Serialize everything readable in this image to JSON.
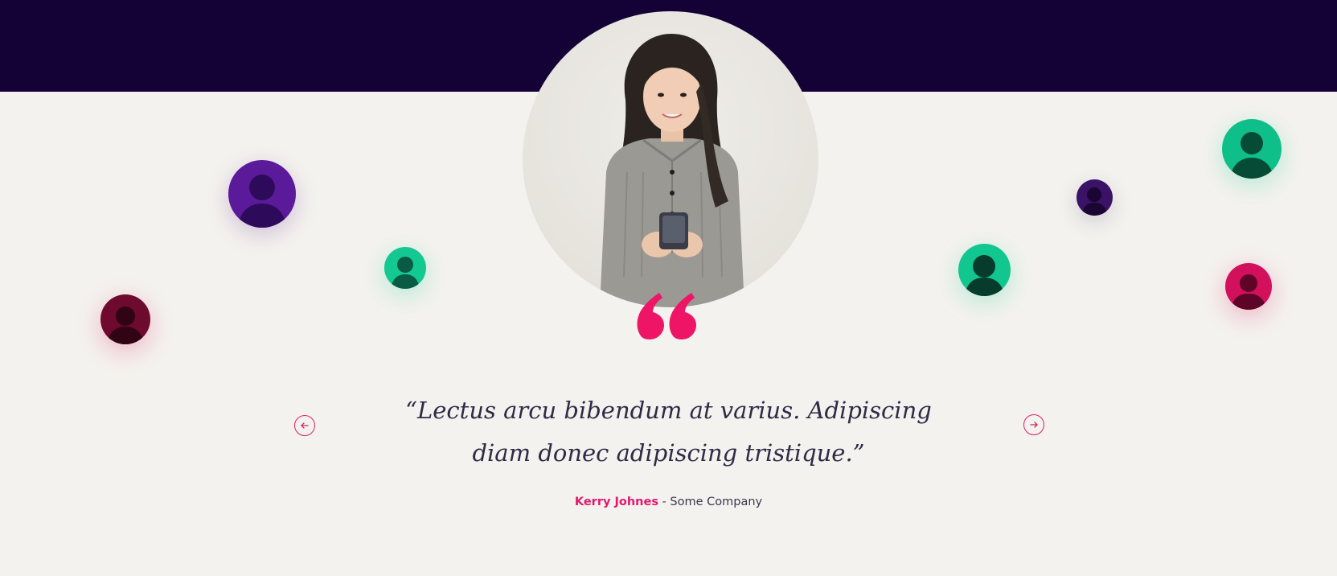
{
  "testimonial": {
    "quote_line_1": "“Lectus arcu bibendum at varius. Adipiscing",
    "quote_line_2": "diam donec adipiscing tristique.”",
    "author": "Kerry Johnes",
    "separator": " - ",
    "company": "Some Company"
  },
  "avatars": [
    {
      "tint": "purple",
      "color": "#5a1a9a"
    },
    {
      "tint": "green",
      "color": "#14c892"
    },
    {
      "tint": "crimson",
      "color": "#6e0a2e"
    },
    {
      "tint": "dark-purple",
      "color": "#3a1266"
    },
    {
      "tint": "green",
      "color": "#0fbf8a"
    },
    {
      "tint": "green",
      "color": "#12c690"
    },
    {
      "tint": "magenta",
      "color": "#d2105c"
    }
  ],
  "icons": {
    "prev": "arrow-left-icon",
    "next": "arrow-right-icon",
    "quote": "quote-mark-icon"
  },
  "colors": {
    "header_band": "#140236",
    "background": "#f4f2ee",
    "accent": "#e1186e",
    "quote_text": "#2f2b45"
  }
}
